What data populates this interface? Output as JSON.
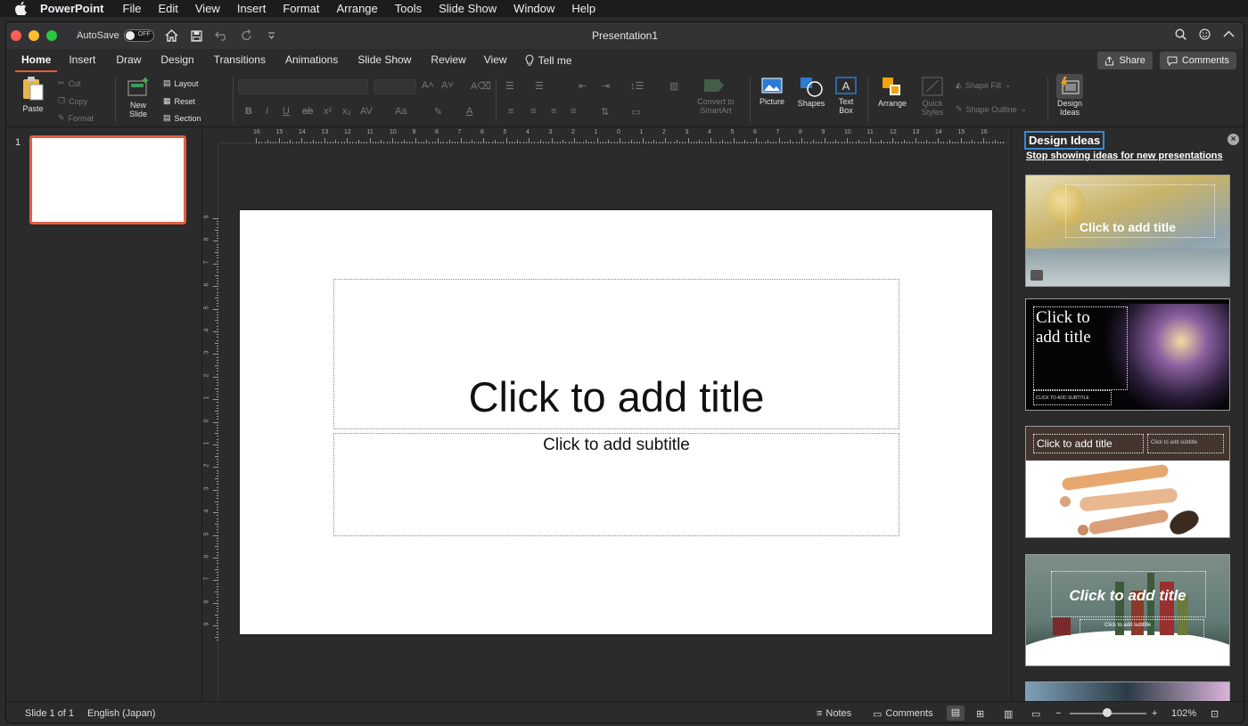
{
  "menubar": {
    "app": "PowerPoint",
    "items": [
      "File",
      "Edit",
      "View",
      "Insert",
      "Format",
      "Arrange",
      "Tools",
      "Slide Show",
      "Window",
      "Help"
    ]
  },
  "window": {
    "title": "Presentation1",
    "autosave_label": "AutoSave",
    "autosave_state": "OFF"
  },
  "tabs": [
    "Home",
    "Insert",
    "Draw",
    "Design",
    "Transitions",
    "Animations",
    "Slide Show",
    "Review",
    "View"
  ],
  "tell_me": "Tell me",
  "share_label": "Share",
  "comments_label": "Comments",
  "ribbon": {
    "paste": "Paste",
    "cut": "Cut",
    "copy": "Copy",
    "format": "Format",
    "new_slide_1": "New",
    "new_slide_2": "Slide",
    "layout": "Layout",
    "reset": "Reset",
    "section": "Section",
    "convert_1": "Convert to",
    "convert_2": "SmartArt",
    "picture": "Picture",
    "shapes": "Shapes",
    "text_box_1": "Text",
    "text_box_2": "Box",
    "arrange": "Arrange",
    "quick_styles_1": "Quick",
    "quick_styles_2": "Styles",
    "shape_fill": "Shape Fill",
    "shape_outline": "Shape Outline",
    "design_ideas_1": "Design",
    "design_ideas_2": "Ideas"
  },
  "thumbnails": {
    "slide_number": "1"
  },
  "slide": {
    "title_placeholder": "Click to add title",
    "subtitle_placeholder": "Click to add subtitle"
  },
  "design_ideas": {
    "header": "Design Ideas",
    "stop_link": "Stop showing ideas for new presentations",
    "card1_title": "Click to add title",
    "card2_title_1": "Click to",
    "card2_title_2": "add title",
    "card2_sub": "CLICK TO ADD SUBTITLE",
    "card3_title": "Click to add title",
    "card3_sub": "Click to add subtitle",
    "card4_title": "Click to add title",
    "card4_sub": "Click to add subtitle"
  },
  "status": {
    "slide_count": "Slide 1 of 1",
    "language": "English (Japan)",
    "notes": "Notes",
    "comments": "Comments",
    "zoom": "102%"
  },
  "ruler": {
    "h_labels": [
      "16",
      "15",
      "14",
      "13",
      "12",
      "11",
      "10",
      "9",
      "8",
      "7",
      "6",
      "5",
      "4",
      "3",
      "2",
      "1",
      "0",
      "1",
      "2",
      "3",
      "4",
      "5",
      "6",
      "7",
      "8",
      "9",
      "10",
      "11",
      "12",
      "13",
      "14",
      "15",
      "16"
    ],
    "v_labels": [
      "9",
      "8",
      "7",
      "6",
      "5",
      "4",
      "3",
      "2",
      "1",
      "0",
      "1",
      "2",
      "3",
      "4",
      "5",
      "6",
      "7",
      "8",
      "9"
    ]
  },
  "colors": {
    "accent": "#e55b3c",
    "selection_blue": "#3a88d0"
  }
}
